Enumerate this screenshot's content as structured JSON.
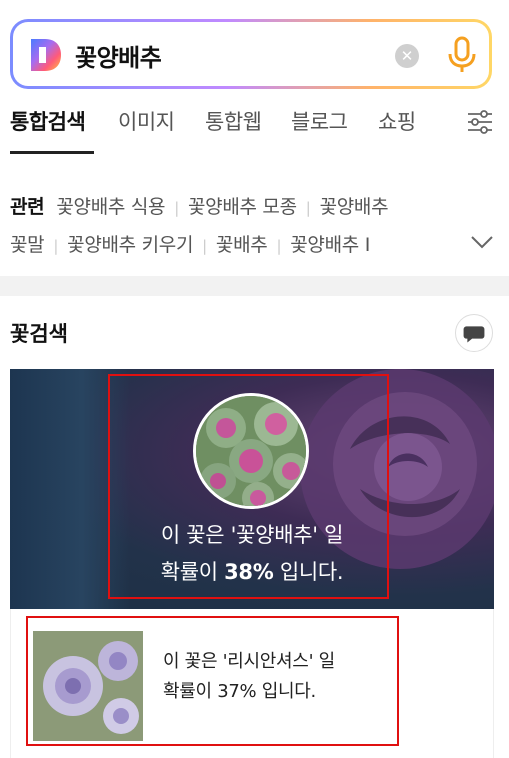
{
  "search": {
    "query": "꽃양배추",
    "clear_icon": "close-circle-icon",
    "mic_icon": "microphone-icon",
    "logo_letter": "D"
  },
  "tabs": [
    {
      "label": "통합검색",
      "active": true
    },
    {
      "label": "이미지",
      "active": false
    },
    {
      "label": "통합웹",
      "active": false
    },
    {
      "label": "블로그",
      "active": false
    },
    {
      "label": "쇼핑",
      "active": false
    }
  ],
  "related": {
    "heading": "관련",
    "row1": [
      "꽃양배추 식용",
      "꽃양배추 모종",
      "꽃양배추"
    ],
    "row2": [
      "꽃말",
      "꽃양배추 키우기",
      "꽃배추",
      "꽃양배추 I"
    ]
  },
  "flower_search": {
    "title": "꽃검색",
    "top_result": {
      "line1": "이 꽃은 '꽃양배추' 일",
      "line2_prefix": "확률이 ",
      "line2_percent": "38%",
      "line2_suffix": " 입니다."
    },
    "second_result": {
      "line1": "이 꽃은 '리시안셔스' 일",
      "line2": "확률이 37% 입니다."
    }
  },
  "colors": {
    "accent_red": "#e01010",
    "mic_orange": "#f5a020",
    "text_dark": "#111111"
  }
}
